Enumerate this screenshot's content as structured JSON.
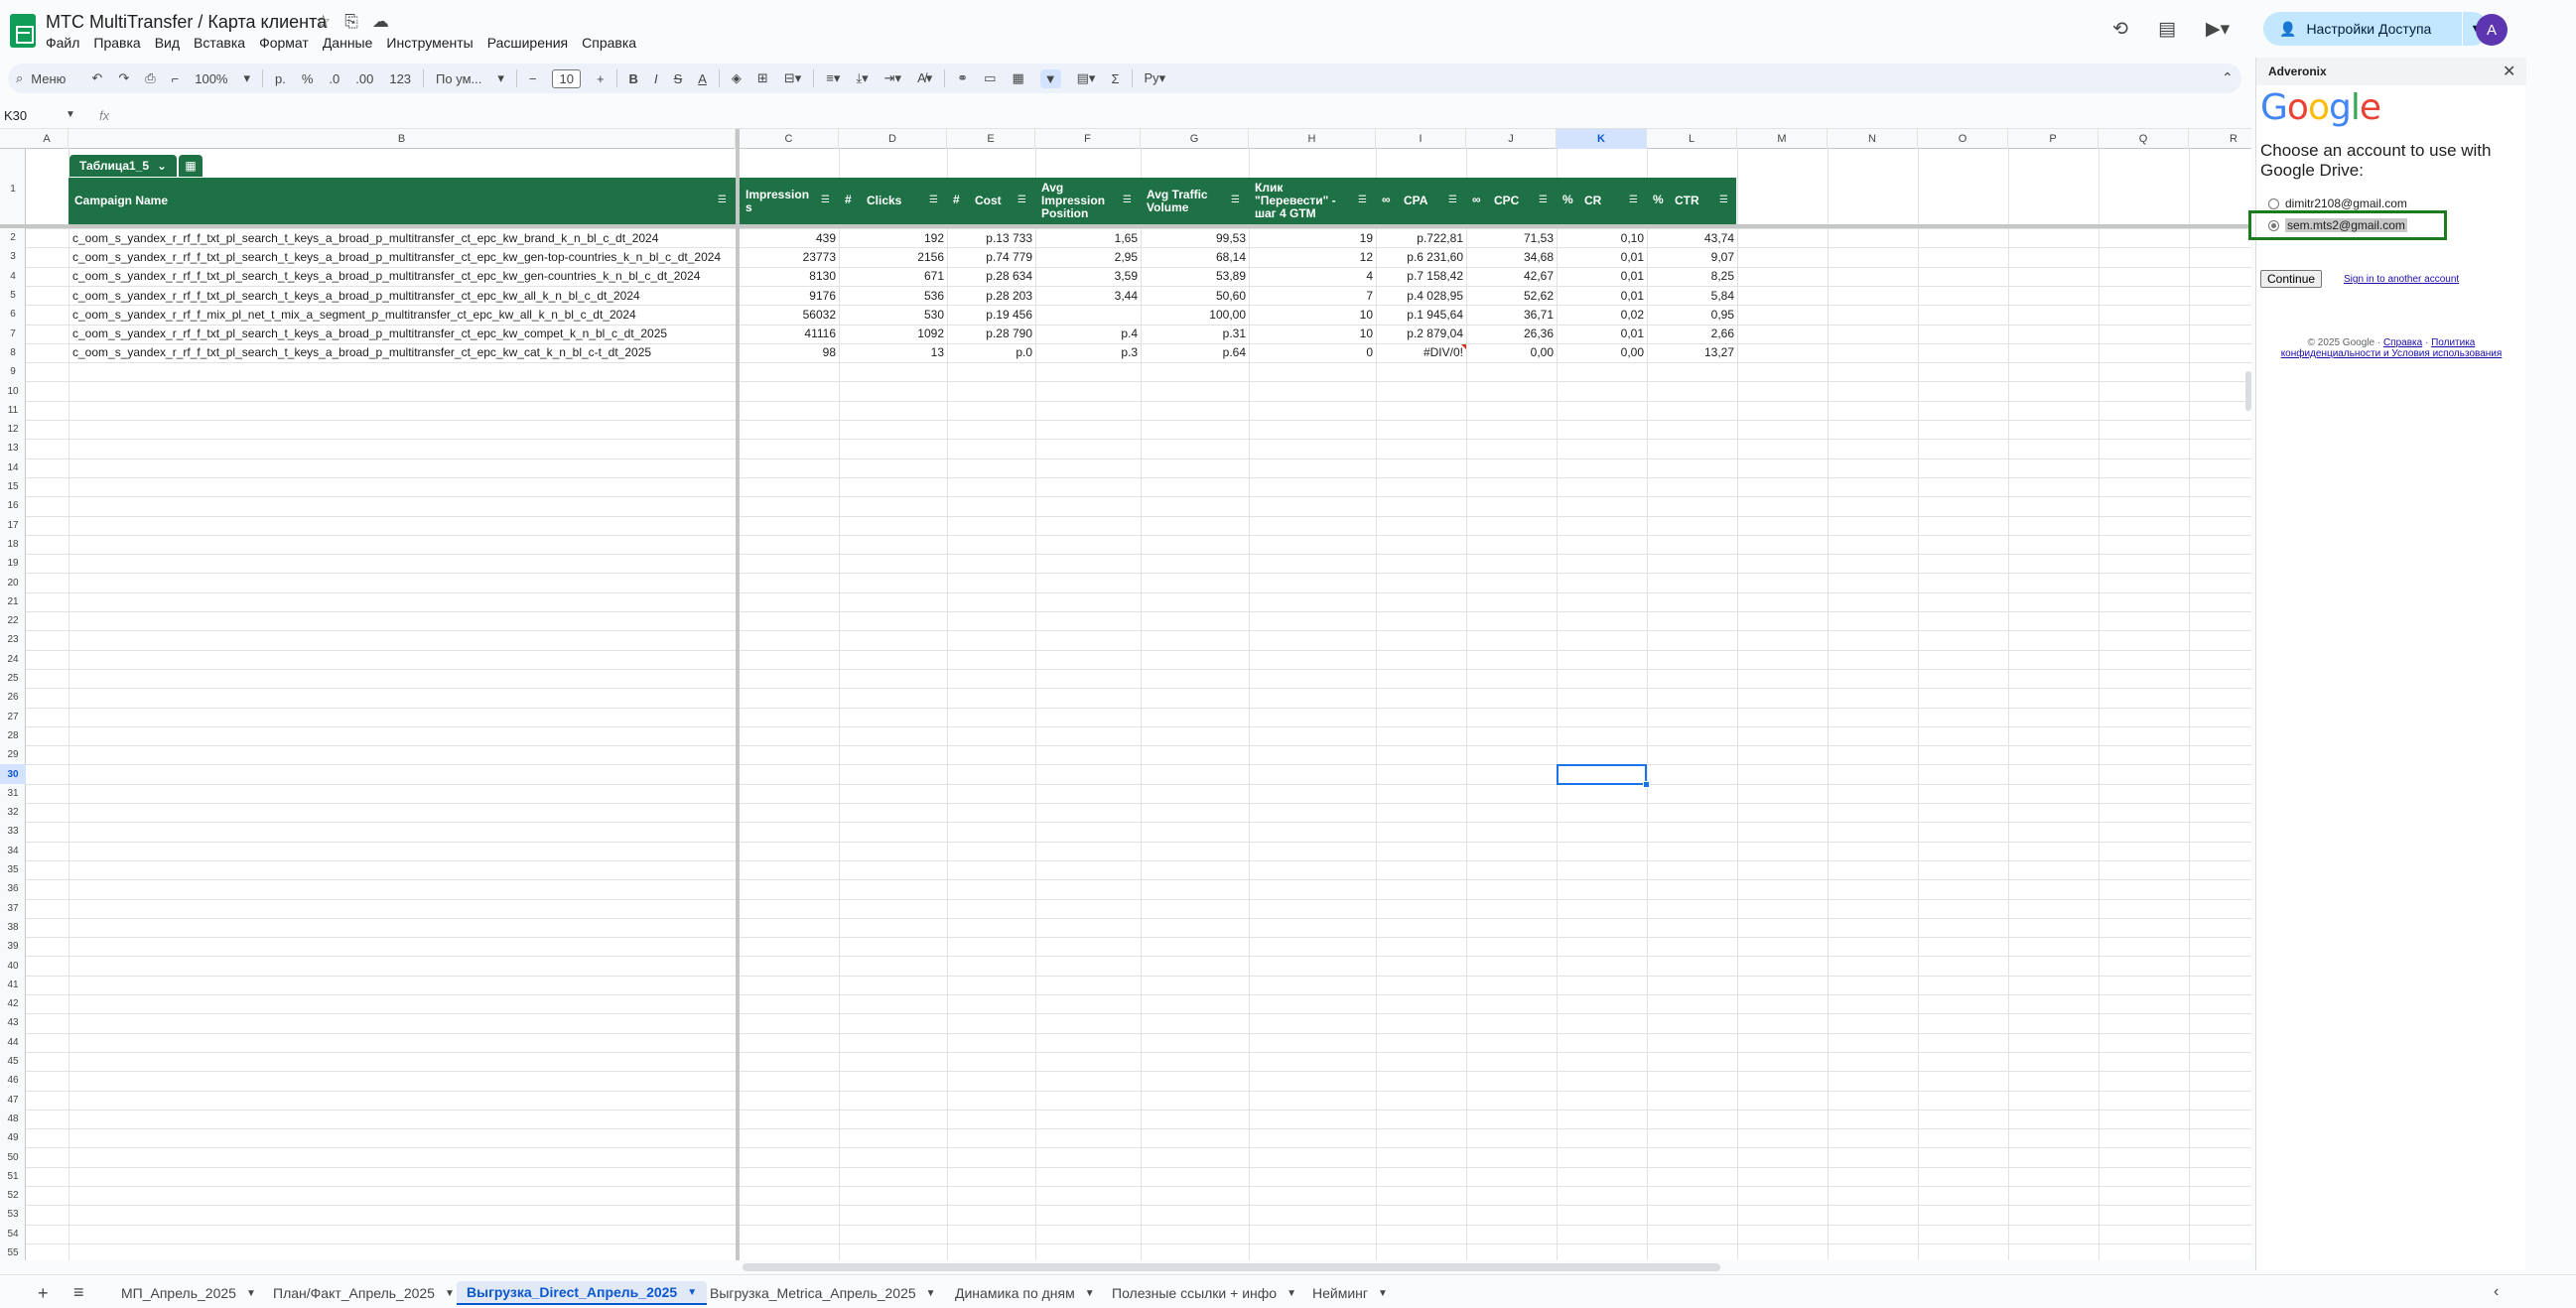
{
  "doc": {
    "title": "МТС MultiTransfer / Карта клиента",
    "menu": [
      "Файл",
      "Правка",
      "Вид",
      "Вставка",
      "Формат",
      "Данные",
      "Инструменты",
      "Расширения",
      "Справка"
    ],
    "share_label": "Настройки Доступа",
    "avatar_letter": "A"
  },
  "toolbar": {
    "search_label": "Меню",
    "zoom": "100%",
    "currency": "р.",
    "percent": "%",
    "dec_less": ".0",
    "dec_more": ".00",
    "number_format": "123",
    "font": "По ум...",
    "font_size": "10",
    "bold": "B",
    "italic": "I",
    "strike": "S",
    "text_color": "A"
  },
  "formula": {
    "name_box": "K30",
    "fx": "fx"
  },
  "grid": {
    "columns": [
      "A",
      "B",
      "C",
      "D",
      "E",
      "F",
      "G",
      "H",
      "I",
      "J",
      "K",
      "L",
      "M",
      "N",
      "O",
      "P",
      "Q",
      "R"
    ],
    "selected_column": "K",
    "selected_row": 30,
    "row_count": 55
  },
  "table": {
    "name": "Таблица1_5",
    "headers": [
      {
        "label": "Campaign Name",
        "type": ""
      },
      {
        "label": "Impression s",
        "type": ""
      },
      {
        "label": "Clicks",
        "type": "#"
      },
      {
        "label": "Cost",
        "type": "#"
      },
      {
        "label": "Avg Impression Position",
        "type": ""
      },
      {
        "label": "Avg Traffic Volume",
        "type": ""
      },
      {
        "label": "Клик \"Перевести\" - шаг 4 GTM",
        "type": ""
      },
      {
        "label": "CPA",
        "type": "∞"
      },
      {
        "label": "CPC",
        "type": "∞"
      },
      {
        "label": "CR",
        "type": "%"
      },
      {
        "label": "CTR",
        "type": "%"
      }
    ],
    "rows": [
      [
        "c_oom_s_yandex_r_rf_f_txt_pl_search_t_keys_a_broad_p_multitransfer_ct_epc_kw_brand_k_n_bl_c_dt_2024",
        "439",
        "192",
        "р.13 733",
        "1,65",
        "99,53",
        "19",
        "р.722,81",
        "71,53",
        "0,10",
        "43,74"
      ],
      [
        "c_oom_s_yandex_r_rf_f_txt_pl_search_t_keys_a_broad_p_multitransfer_ct_epc_kw_gen-top-countries_k_n_bl_c_dt_2024",
        "23773",
        "2156",
        "р.74 779",
        "2,95",
        "68,14",
        "12",
        "р.6 231,60",
        "34,68",
        "0,01",
        "9,07"
      ],
      [
        "c_oom_s_yandex_r_rf_f_txt_pl_search_t_keys_a_broad_p_multitransfer_ct_epc_kw_gen-countries_k_n_bl_c_dt_2024",
        "8130",
        "671",
        "р.28 634",
        "3,59",
        "53,89",
        "4",
        "р.7 158,42",
        "42,67",
        "0,01",
        "8,25"
      ],
      [
        "c_oom_s_yandex_r_rf_f_txt_pl_search_t_keys_a_broad_p_multitransfer_ct_epc_kw_all_k_n_bl_c_dt_2024",
        "9176",
        "536",
        "р.28 203",
        "3,44",
        "50,60",
        "7",
        "р.4 028,95",
        "52,62",
        "0,01",
        "5,84"
      ],
      [
        "c_oom_s_yandex_r_rf_f_mix_pl_net_t_mix_a_segment_p_multitransfer_ct_epc_kw_all_k_n_bl_c_dt_2024",
        "56032",
        "530",
        "р.19 456",
        "",
        "100,00",
        "10",
        "р.1 945,64",
        "36,71",
        "0,02",
        "0,95"
      ],
      [
        "c_oom_s_yandex_r_rf_f_txt_pl_search_t_keys_a_broad_p_multitransfer_ct_epc_kw_compet_k_n_bl_c_dt_2025",
        "41116",
        "1092",
        "р.28 790",
        "р.4",
        "р.31",
        "10",
        "р.2 879,04",
        "26,36",
        "0,01",
        "2,66"
      ],
      [
        "c_oom_s_yandex_r_rf_f_txt_pl_search_t_keys_a_broad_p_multitransfer_ct_epc_kw_cat_k_n_bl_c-t_dt_2025",
        "98",
        "13",
        "р.0",
        "р.3",
        "р.64",
        "0",
        "#DIV/0!",
        "0,00",
        "0,00",
        "13,27"
      ]
    ]
  },
  "sheets": [
    {
      "label": "МП_Апрель_2025",
      "active": false
    },
    {
      "label": "План/Факт_Апрель_2025",
      "active": false
    },
    {
      "label": "Выгрузка_Direct_Апрель_2025",
      "active": true
    },
    {
      "label": "Выгрузка_Metrica_Апрель_2025",
      "active": false
    },
    {
      "label": "Динамика по дням",
      "active": false
    },
    {
      "label": "Полезные ссылки + инфо",
      "active": false
    },
    {
      "label": "Нейминг",
      "active": false
    }
  ],
  "sidebar": {
    "title": "Adveronix",
    "google_letters": [
      "G",
      "o",
      "o",
      "g",
      "l",
      "e"
    ],
    "heading": "Choose an account to use with Google Drive:",
    "accounts": [
      "dimitr2108@gmail.com",
      "sem.mts2@gmail.com"
    ],
    "selected_account": 1,
    "continue_label": "Continue",
    "another_account_label": "Sign in to another account",
    "footer_copyright": "© 2025 Google",
    "footer_help": "Справка",
    "footer_policy": "Политика конфиденциальности и Условия использования"
  }
}
